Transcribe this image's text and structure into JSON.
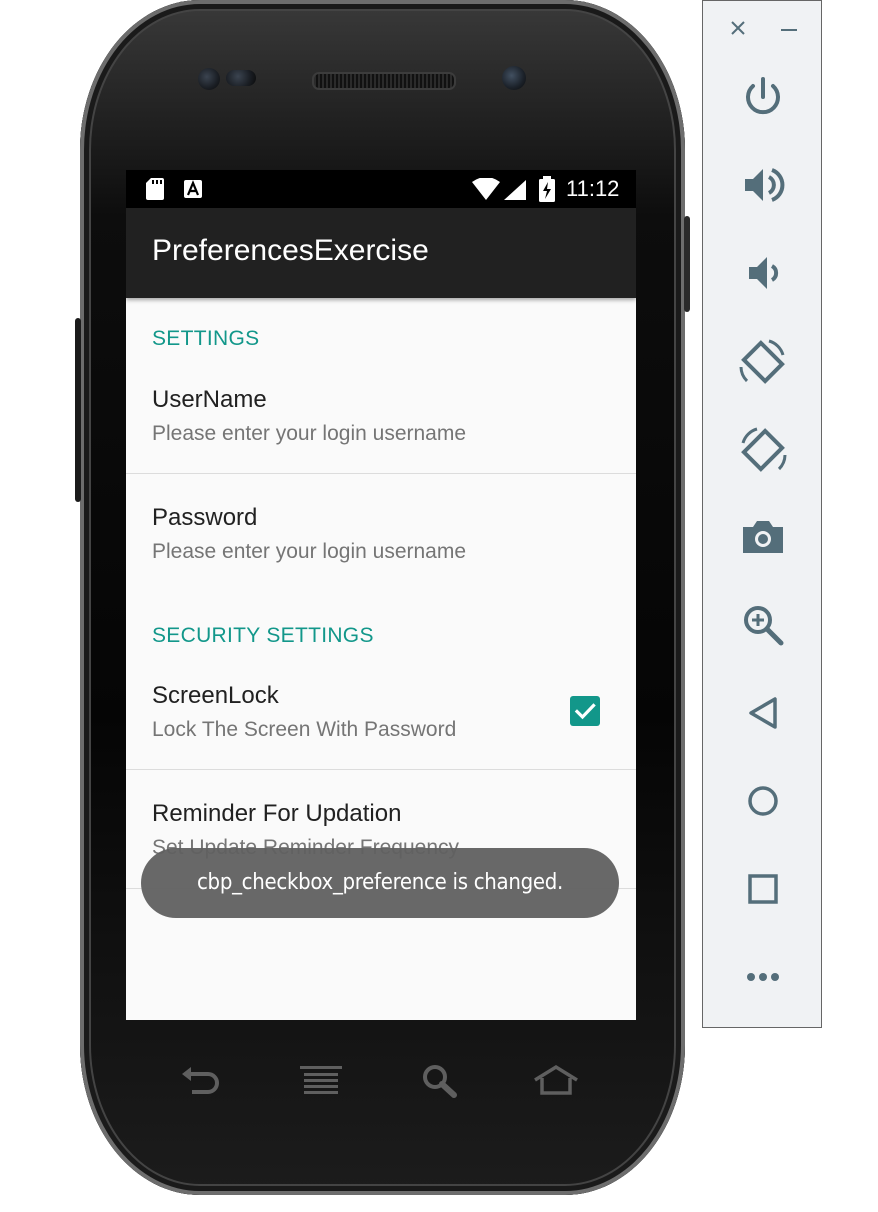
{
  "status_bar": {
    "time": "11:12",
    "icons": [
      "sd-card-icon",
      "a-notification-icon",
      "wifi-icon",
      "signal-icon",
      "battery-charging-icon"
    ]
  },
  "app": {
    "title": "PreferencesExercise"
  },
  "sections": [
    {
      "header": "SETTINGS",
      "items": [
        {
          "title": "UserName",
          "summary": "Please enter your login username"
        },
        {
          "title": "Password",
          "summary": "Please enter your login username"
        }
      ]
    },
    {
      "header": "SECURITY SETTINGS",
      "items": [
        {
          "title": "ScreenLock",
          "summary": "Lock The Screen With Password",
          "checked": true
        },
        {
          "title": "Reminder For Updation",
          "summary": "Set Update Reminder Frequency"
        }
      ]
    }
  ],
  "toast": {
    "text": "cbp_checkbox_preference  is changed."
  },
  "hardware_buttons": [
    "back-icon",
    "menu-icon",
    "search-icon",
    "home-icon"
  ],
  "emulator_toolbar": {
    "icons": [
      "power-icon",
      "volume-up-icon",
      "volume-down-icon",
      "rotate-left-icon",
      "rotate-right-icon",
      "camera-icon",
      "zoom-icon",
      "back-triangle-icon",
      "home-circle-icon",
      "overview-square-icon",
      "more-icon"
    ]
  },
  "colors": {
    "accent": "#12978a",
    "appbar": "#212121",
    "background": "#fafafa",
    "toast": "#606060",
    "toolbar_icon": "#546e7a"
  }
}
